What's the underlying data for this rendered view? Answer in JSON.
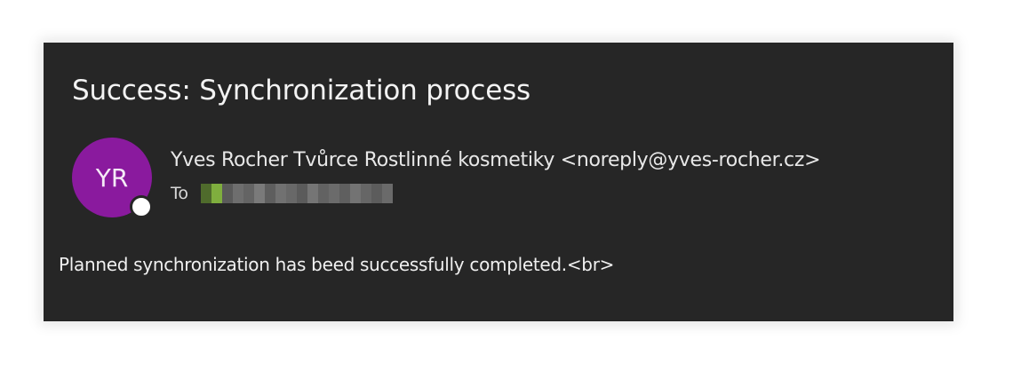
{
  "email": {
    "subject": "Success: Synchronization process",
    "avatar_initials": "YR",
    "avatar_color": "#8a1a9e",
    "sender": "Yves Rocher Tvůrce Rostlinné kosmetiky <noreply@yves-rocher.cz>",
    "to_label": "To",
    "recipient_redacted": true,
    "body": "Planned synchronization has beed successfully completed.<br>"
  },
  "colors": {
    "background": "#262626",
    "text": "#f0f0f0"
  }
}
